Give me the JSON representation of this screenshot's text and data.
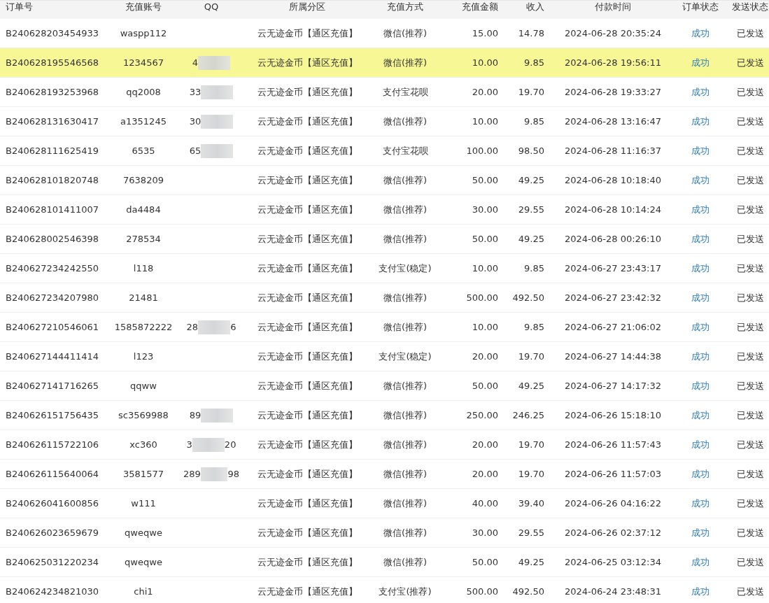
{
  "table": {
    "columns": [
      "订单号",
      "充值账号",
      "QQ",
      "所属分区",
      "充值方式",
      "充值金额",
      "收入",
      "付款时间",
      "订单状态",
      "发送状态"
    ],
    "rows": [
      {
        "order": "B240628203454933",
        "account": "waspp112",
        "qq": {
          "redacted": false
        },
        "zone": "云无迹金币【通区充值】",
        "method": "微信(推荐)",
        "amount": "15.00",
        "income": "14.78",
        "time": "2024-06-28 20:35:24",
        "status": "成功",
        "send": "已发送",
        "selected": false
      },
      {
        "order": "B240628195546568",
        "account": "1234567",
        "qq": {
          "start": "4",
          "redacted": true
        },
        "zone": "云无迹金币【通区充值】",
        "method": "微信(推荐)",
        "amount": "10.00",
        "income": "9.85",
        "time": "2024-06-28 19:56:11",
        "status": "成功",
        "send": "已发送",
        "selected": true
      },
      {
        "order": "B240628193253968",
        "account": "qq2008",
        "qq": {
          "start": "33",
          "redacted": true
        },
        "zone": "云无迹金币【通区充值】",
        "method": "支付宝花呗",
        "amount": "20.00",
        "income": "19.70",
        "time": "2024-06-28 19:33:27",
        "status": "成功",
        "send": "已发送",
        "selected": false
      },
      {
        "order": "B240628131630417",
        "account": "a1351245",
        "qq": {
          "start": "30",
          "redacted": true
        },
        "zone": "云无迹金币【通区充值】",
        "method": "微信(推荐)",
        "amount": "10.00",
        "income": "9.85",
        "time": "2024-06-28 13:16:47",
        "status": "成功",
        "send": "已发送",
        "selected": false
      },
      {
        "order": "B240628111625419",
        "account": "6535",
        "qq": {
          "start": "65",
          "redacted": true
        },
        "zone": "云无迹金币【通区充值】",
        "method": "支付宝花呗",
        "amount": "100.00",
        "income": "98.50",
        "time": "2024-06-28 11:16:37",
        "status": "成功",
        "send": "已发送",
        "selected": false
      },
      {
        "order": "B240628101820748",
        "account": "7638209",
        "qq": {
          "redacted": false
        },
        "zone": "云无迹金币【通区充值】",
        "method": "微信(推荐)",
        "amount": "50.00",
        "income": "49.25",
        "time": "2024-06-28 10:18:40",
        "status": "成功",
        "send": "已发送",
        "selected": false
      },
      {
        "order": "B240628101411007",
        "account": "da4484",
        "qq": {
          "redacted": false
        },
        "zone": "云无迹金币【通区充值】",
        "method": "微信(推荐)",
        "amount": "30.00",
        "income": "29.55",
        "time": "2024-06-28 10:14:24",
        "status": "成功",
        "send": "已发送",
        "selected": false
      },
      {
        "order": "B240628002546398",
        "account": "278534",
        "qq": {
          "redacted": false
        },
        "zone": "云无迹金币【通区充值】",
        "method": "微信(推荐)",
        "amount": "50.00",
        "income": "49.25",
        "time": "2024-06-28 00:26:10",
        "status": "成功",
        "send": "已发送",
        "selected": false
      },
      {
        "order": "B240627234242550",
        "account": "l118",
        "qq": {
          "redacted": false
        },
        "zone": "云无迹金币【通区充值】",
        "method": "支付宝(稳定)",
        "amount": "10.00",
        "income": "9.85",
        "time": "2024-06-27 23:43:17",
        "status": "成功",
        "send": "已发送",
        "selected": false
      },
      {
        "order": "B240627234207980",
        "account": "21481",
        "qq": {
          "redacted": false
        },
        "zone": "云无迹金币【通区充值】",
        "method": "微信(推荐)",
        "amount": "500.00",
        "income": "492.50",
        "time": "2024-06-27 23:42:32",
        "status": "成功",
        "send": "已发送",
        "selected": false
      },
      {
        "order": "B240627210546061",
        "account": "1585872222",
        "qq": {
          "start": "28",
          "end": "6",
          "redacted": true
        },
        "zone": "云无迹金币【通区充值】",
        "method": "微信(推荐)",
        "amount": "10.00",
        "income": "9.85",
        "time": "2024-06-27 21:06:02",
        "status": "成功",
        "send": "已发送",
        "selected": false
      },
      {
        "order": "B240627144411414",
        "account": "l123",
        "qq": {
          "redacted": false
        },
        "zone": "云无迹金币【通区充值】",
        "method": "支付宝(稳定)",
        "amount": "20.00",
        "income": "19.70",
        "time": "2024-06-27 14:44:38",
        "status": "成功",
        "send": "已发送",
        "selected": false
      },
      {
        "order": "B240627141716265",
        "account": "qqww",
        "qq": {
          "redacted": false
        },
        "zone": "云无迹金币【通区充值】",
        "method": "微信(推荐)",
        "amount": "50.00",
        "income": "49.25",
        "time": "2024-06-27 14:17:32",
        "status": "成功",
        "send": "已发送",
        "selected": false
      },
      {
        "order": "B240626151756435",
        "account": "sc3569988",
        "qq": {
          "start": "89",
          "redacted": true
        },
        "zone": "云无迹金币【通区充值】",
        "method": "微信(推荐)",
        "amount": "250.00",
        "income": "246.25",
        "time": "2024-06-26 15:18:10",
        "status": "成功",
        "send": "已发送",
        "selected": false
      },
      {
        "order": "B240626115722106",
        "account": "xc360",
        "qq": {
          "start": "3",
          "end": "20",
          "redacted": true
        },
        "zone": "云无迹金币【通区充值】",
        "method": "微信(推荐)",
        "amount": "20.00",
        "income": "19.70",
        "time": "2024-06-26 11:57:43",
        "status": "成功",
        "send": "已发送",
        "selected": false
      },
      {
        "order": "B240626115640064",
        "account": "3581577",
        "qq": {
          "start": "289",
          "end": "98",
          "redacted": true
        },
        "zone": "云无迹金币【通区充值】",
        "method": "微信(推荐)",
        "amount": "20.00",
        "income": "19.70",
        "time": "2024-06-26 11:57:03",
        "status": "成功",
        "send": "已发送",
        "selected": false
      },
      {
        "order": "B240626041600856",
        "account": "w111",
        "qq": {
          "redacted": false
        },
        "zone": "云无迹金币【通区充值】",
        "method": "微信(推荐)",
        "amount": "40.00",
        "income": "39.40",
        "time": "2024-06-26 04:16:22",
        "status": "成功",
        "send": "已发送",
        "selected": false
      },
      {
        "order": "B240626023659679",
        "account": "qweqwe",
        "qq": {
          "redacted": false
        },
        "zone": "云无迹金币【通区充值】",
        "method": "微信(推荐)",
        "amount": "30.00",
        "income": "29.55",
        "time": "2024-06-26 02:37:12",
        "status": "成功",
        "send": "已发送",
        "selected": false
      },
      {
        "order": "B240625031220234",
        "account": "qweqwe",
        "qq": {
          "redacted": false
        },
        "zone": "云无迹金币【通区充值】",
        "method": "微信(推荐)",
        "amount": "50.00",
        "income": "49.25",
        "time": "2024-06-25 03:12:34",
        "status": "成功",
        "send": "已发送",
        "selected": false
      },
      {
        "order": "B240624234821030",
        "account": "chi1",
        "qq": {
          "redacted": false
        },
        "zone": "云无迹金币【通区充值】",
        "method": "支付宝(推荐)",
        "amount": "500.00",
        "income": "492.50",
        "time": "2024-06-24 23:48:31",
        "status": "成功",
        "send": "已发送",
        "selected": false
      }
    ]
  }
}
